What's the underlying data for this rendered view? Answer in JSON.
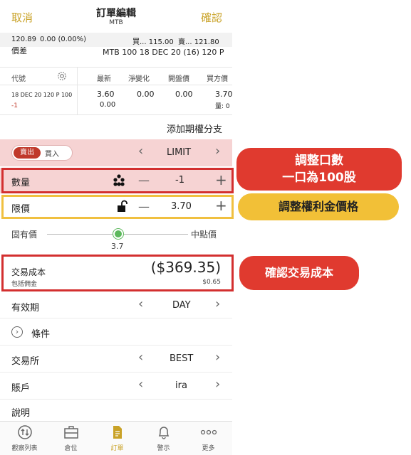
{
  "header": {
    "cancel_label": "取消",
    "title": "訂單編輯",
    "subtitle": "MTB",
    "confirm_label": "確認"
  },
  "quote": {
    "last": "120.89",
    "change": "0.00 (0.00%)",
    "bid": "買... 115.00",
    "ask": "賣... 121.80"
  },
  "spread": {
    "label": "價差",
    "value": "MTB 100 18 DEC 20 (16) 120 P"
  },
  "legs_table": {
    "headers": [
      "代號",
      "最新",
      "淨變化",
      "開盤價",
      "買方價"
    ],
    "row": {
      "symbol": "18 DEC 20 120 P 100",
      "qty": "-1",
      "last": "3.60",
      "last_sub": "0.00",
      "net_change": "0.00",
      "open": "0.00",
      "bid": "3.70",
      "bid_sub": "量: 0"
    }
  },
  "add_leg_label": "添加期權分支",
  "side": {
    "sell_label": "賣出",
    "buy_label": "買入",
    "order_type": "LIMIT"
  },
  "quantity": {
    "label": "數量",
    "value": "-1"
  },
  "limit": {
    "label": "限價",
    "value": "3.70"
  },
  "slider": {
    "left_label": "固有價",
    "right_label": "中點價",
    "value": "3.7"
  },
  "cost": {
    "label": "交易成本",
    "sublabel": "包括佣金",
    "value": "($369.35)",
    "commission": "$0.65"
  },
  "validity": {
    "label": "有效期",
    "value": "DAY"
  },
  "conditions_label": "條件",
  "exchange": {
    "label": "交易所",
    "value": "BEST"
  },
  "account": {
    "label": "賬戶",
    "value": "ira"
  },
  "description_label": "說明",
  "tabs": [
    {
      "label": "觀察列表",
      "icon": "watchlist-icon"
    },
    {
      "label": "倉位",
      "icon": "briefcase-icon"
    },
    {
      "label": "訂單",
      "icon": "document-icon"
    },
    {
      "label": "警示",
      "icon": "bell-icon"
    },
    {
      "label": "更多",
      "icon": "more-icon"
    }
  ],
  "callouts": {
    "qty_line1": "調整口數",
    "qty_line2": "一口為100股",
    "premium": "調整權利金價格",
    "cost": "確認交易成本"
  },
  "colors": {
    "accent_gold": "#c9a227",
    "sell_red": "#c0392b",
    "callout_red": "#e03a2f",
    "callout_yellow": "#f2c037",
    "highlight_pink": "#f6d3d3"
  }
}
